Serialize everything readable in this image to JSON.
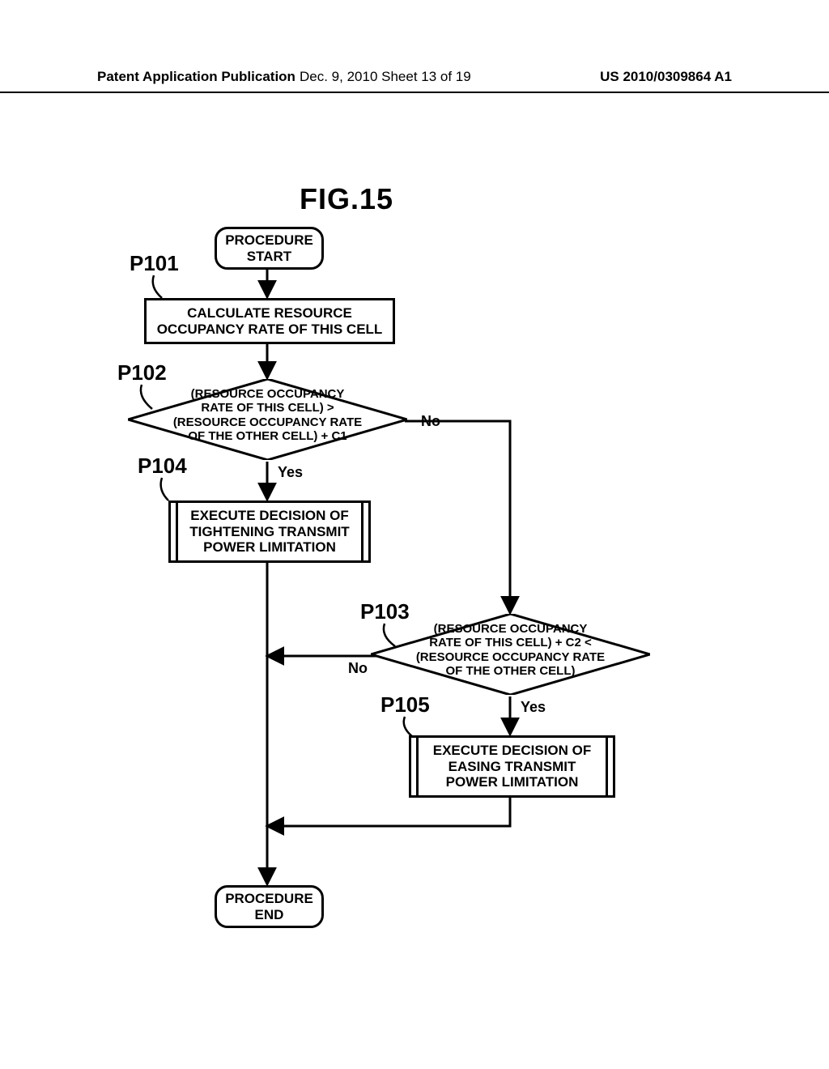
{
  "header": {
    "left": "Patent Application Publication",
    "center": "Dec. 9, 2010  Sheet 13 of 19",
    "right": "US 2010/0309864 A1"
  },
  "figure_title": "FIG.15",
  "nodes": {
    "start": "PROCEDURE\nSTART",
    "p101": "CALCULATE RESOURCE\nOCCUPANCY RATE OF THIS CELL",
    "p102": "(RESOURCE OCCUPANCY\nRATE OF THIS CELL) >\n(RESOURCE OCCUPANCY RATE\nOF THE OTHER CELL) + C1",
    "p103": "(RESOURCE OCCUPANCY\nRATE OF THIS CELL) + C2 <\n(RESOURCE OCCUPANCY RATE\nOF THE OTHER CELL)",
    "p104": "EXECUTE DECISION OF\nTIGHTENING TRANSMIT\nPOWER LIMITATION",
    "p105": "EXECUTE DECISION OF\nEASING TRANSMIT\nPOWER LIMITATION",
    "end": "PROCEDURE\nEND"
  },
  "labels": {
    "p101": "P101",
    "p102": "P102",
    "p103": "P103",
    "p104": "P104",
    "p105": "P105"
  },
  "edges": {
    "yes": "Yes",
    "no": "No"
  }
}
